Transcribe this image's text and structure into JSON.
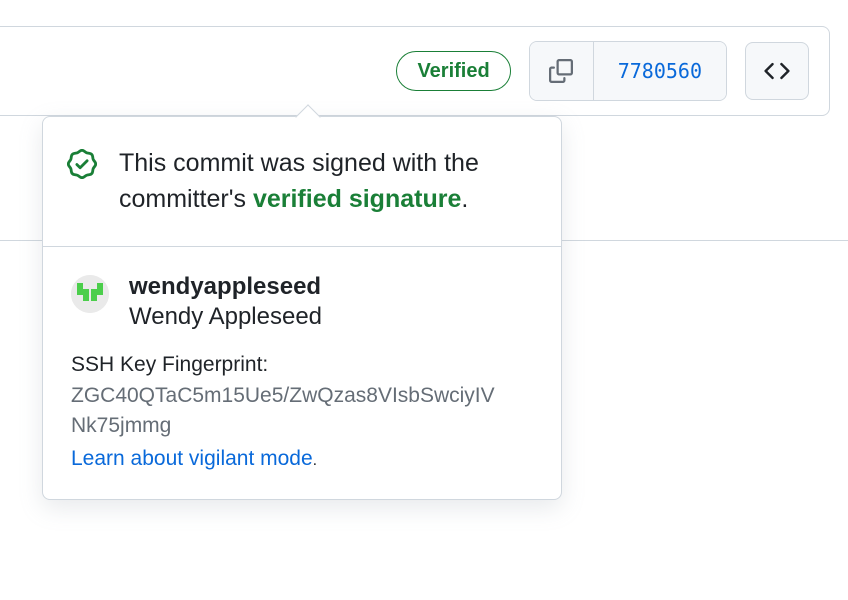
{
  "bar": {
    "verified_label": "Verified",
    "commit_sha_short": "7780560"
  },
  "popover": {
    "msg_pre": "This commit was signed with the committer's ",
    "verified_signature_link": "verified signature",
    "msg_post": ".",
    "user": {
      "username": "wendyappleseed",
      "fullname": "Wendy Appleseed"
    },
    "fingerprint_label": "SSH Key Fingerprint:",
    "fingerprint_value": "ZGC40QTaC5m15Ue5/ZwQzas8VIsbSwciyIVNk75jmmg",
    "learn_link": "Learn about vigilant mode",
    "learn_post": "."
  }
}
